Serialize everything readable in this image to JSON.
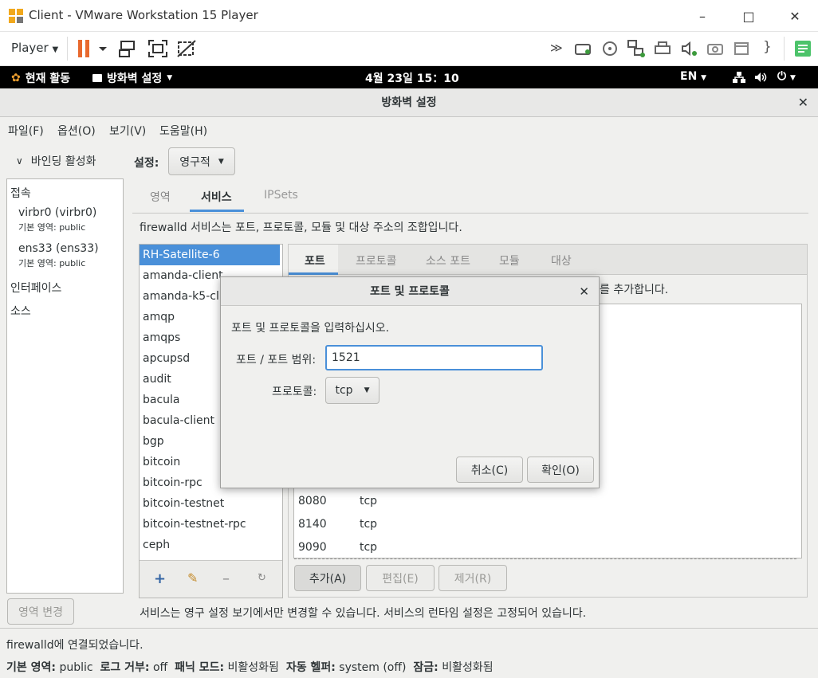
{
  "vmware": {
    "title": "Client - VMware Workstation 15 Player",
    "player_menu": "Player",
    "window_buttons": [
      "minimize-icon",
      "maximize-icon",
      "close-icon"
    ]
  },
  "gnome_topbar": {
    "activities": "현재 활동",
    "app_menu": "방화벽 설정",
    "clock": "4월 23일  15：10",
    "language": "EN"
  },
  "app": {
    "title": "방화벽 설정",
    "menu": [
      "파일(F)",
      "옵션(O)",
      "보기(V)",
      "도움말(H)"
    ],
    "sidebar": {
      "binding_toggle": "바인딩 활성화",
      "section_connections": "접속",
      "connections": [
        {
          "name": "virbr0 (virbr0)",
          "zone_label": "기본 영역:",
          "zone": "public"
        },
        {
          "name": "ens33 (ens33)",
          "zone_label": "기본 영역:",
          "zone": "public"
        }
      ],
      "section_interfaces": "인터페이스",
      "section_sources": "소스",
      "change_zone_button": "영역 변경"
    },
    "config": {
      "label": "설정:",
      "value": "영구적"
    },
    "main_tabs": [
      "영역",
      "서비스",
      "IPSets"
    ],
    "active_main_tab": "서비스",
    "service_description": "firewalld 서비스는 포트, 프로토콜, 모듈 및 대상 주소의 조합입니다.",
    "services": [
      "RH-Satellite-6",
      "amanda-client",
      "amanda-k5-client",
      "amqp",
      "amqps",
      "apcupsd",
      "audit",
      "bacula",
      "bacula-client",
      "bgp",
      "bitcoin",
      "bitcoin-rpc",
      "bitcoin-testnet",
      "bitcoin-testnet-rpc",
      "ceph"
    ],
    "selected_service": "RH-Satellite-6",
    "sub_tabs": [
      "포트",
      "프로토콜",
      "소스 포트",
      "모듈",
      "대상"
    ],
    "active_sub_tab": "포트",
    "ports_hint": "를 추가합니다.",
    "ports": [
      {
        "port": "8080",
        "protocol": "tcp"
      },
      {
        "port": "8140",
        "protocol": "tcp"
      },
      {
        "port": "9090",
        "protocol": "tcp"
      }
    ],
    "port_buttons": {
      "add": "추가(A)",
      "edit": "편집(E)",
      "remove": "제거(R)"
    },
    "footer_note": "서비스는 영구 설정 보기에서만 변경할 수 있습니다. 서비스의 런타임 설정은 고정되어 있습니다.",
    "status": {
      "connection": "firewalld에 연결되었습니다.",
      "default_zone_label": "기본 영역:",
      "default_zone": "public",
      "log_denied_label": "로그 거부:",
      "log_denied": "off",
      "panic_label": "패닉 모드:",
      "panic": "비활성화됨",
      "helper_label": "자동 헬퍼:",
      "helper": "system (off)",
      "lockdown_label": "잠금:",
      "lockdown": "비활성화됨"
    }
  },
  "dialog": {
    "title": "포트 및 프로토콜",
    "prompt": "포트 및 프로토콜을 입력하십시오.",
    "port_label": "포트 / 포트 범위:",
    "port_value": "1521",
    "protocol_label": "프로토콜:",
    "protocol_value": "tcp",
    "cancel": "취소(C)",
    "ok": "확인(O)"
  },
  "colors": {
    "accent": "#4a90d9",
    "pause_orange": "#e8692e",
    "topbar": "#000000"
  }
}
